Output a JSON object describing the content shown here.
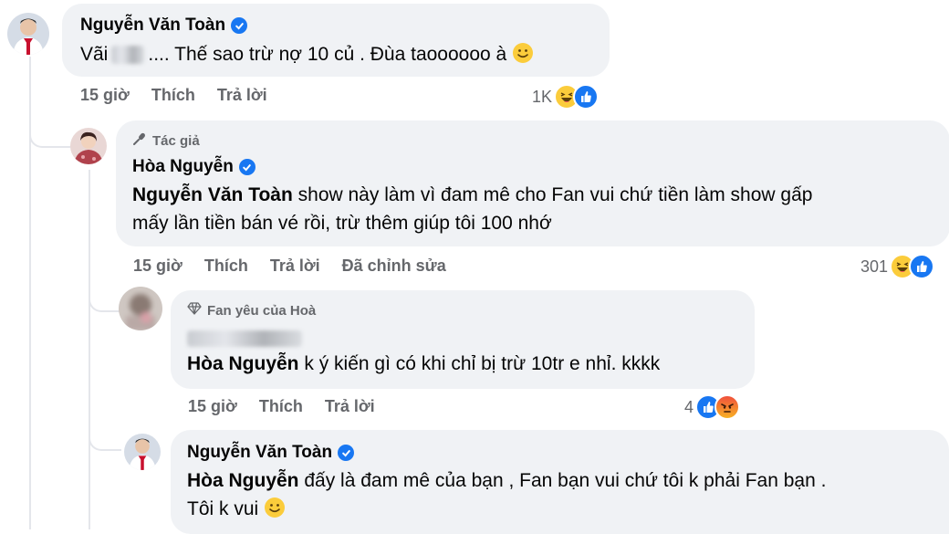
{
  "comments": [
    {
      "author": "Nguyễn Văn Toàn",
      "text_before": "Vãi",
      "text_after": ".... Thế sao trừ nợ 10 củ . Đùa taoooooo à",
      "time": "15 giờ",
      "like_label": "Thích",
      "reply_label": "Trả lời",
      "reaction_count": "1K",
      "reactions": [
        "haha",
        "like"
      ]
    },
    {
      "badge": "Tác giả",
      "author": "Hòa Nguyễn",
      "mention": "Nguyễn Văn Toàn",
      "text_line1": "show này làm vì đam mê cho Fan vui chứ tiền làm show gấp",
      "text_line2": "mấy lần tiền bán vé rồi, trừ thêm giúp tôi 100 nhớ",
      "time": "15 giờ",
      "like_label": "Thích",
      "reply_label": "Trả lời",
      "edited_label": "Đã chỉnh sửa",
      "reaction_count": "301",
      "reactions": [
        "haha",
        "like"
      ]
    },
    {
      "badge": "Fan yêu của Hoà",
      "mention": "Hòa Nguyễn",
      "text": "k ý kiến gì có khi chỉ bị trừ 10tr e nhỉ. kkkk",
      "time": "15 giờ",
      "like_label": "Thích",
      "reply_label": "Trả lời",
      "reaction_count": "4",
      "reactions": [
        "like",
        "angry"
      ]
    },
    {
      "author": "Nguyễn Văn Toàn",
      "mention": "Hòa Nguyễn",
      "text_line1": "đấy là đam mê của bạn , Fan bạn vui chứ tôi k phải Fan bạn .",
      "text_line2": "Tôi k vui"
    }
  ],
  "colors": {
    "bubble": "#f0f2f5",
    "meta_text": "#65676b",
    "verified": "#1877f2",
    "thread_line": "#e4e6eb"
  }
}
